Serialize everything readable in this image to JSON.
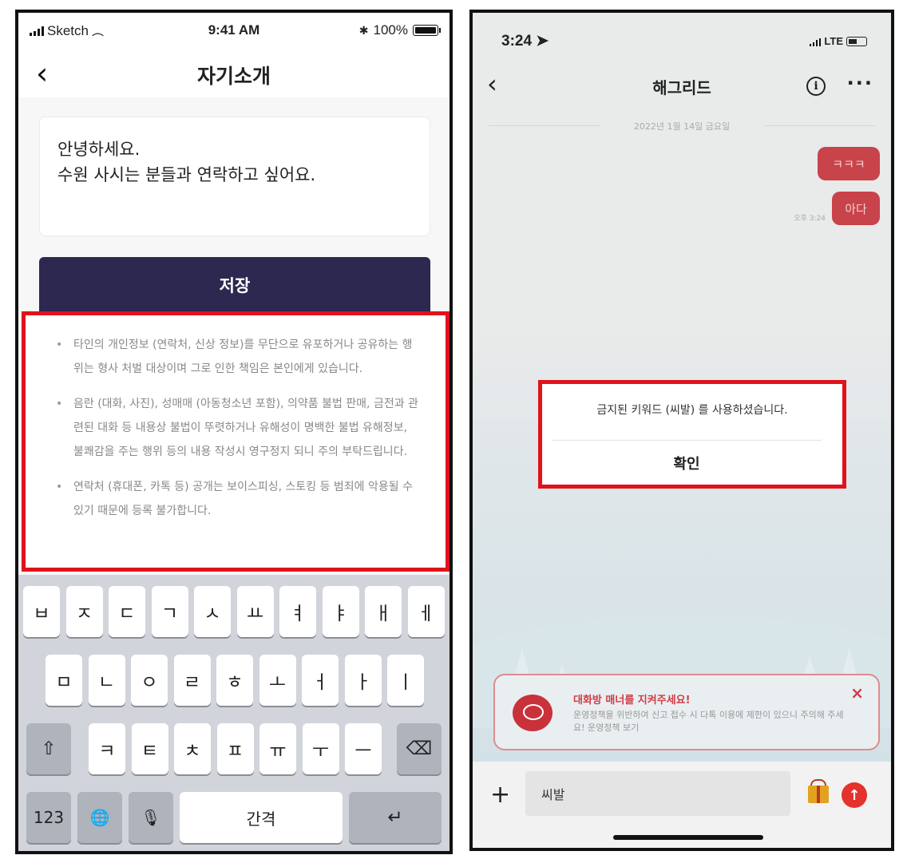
{
  "left": {
    "status": {
      "carrier": "Sketch",
      "time": "9:41 AM",
      "battery": "100%"
    },
    "header": {
      "back": "‹",
      "title": "자기소개"
    },
    "intro": {
      "line1": "안녕하세요.",
      "line2": "수원 사시는 분들과 연락하고 싶어요."
    },
    "save_label": "저장",
    "notices": [
      "타인의 개인정보 (연락처, 신상 정보)를 무단으로 유포하거나 공유하는 행위는 형사 처벌 대상이며 그로 인한 책임은 본인에게 있습니다.",
      "음란 (대화, 사진), 성매매 (아동청소년 포함), 의약품 불법 판매, 금전과 관련된 대화 등 내용상 불법이 뚜렷하거나 유해성이 명백한 불법 유해정보, 불쾌감을 주는 행위 등의 내용 작성시 영구정지 되니 주의 부탁드립니다.",
      "연락처 (휴대폰, 카톡 등) 공개는 보이스피싱, 스토킹 등 범죄에 악용될 수 있기 때문에 등록 불가합니다."
    ],
    "keyboard": {
      "row1": [
        "ㅂ",
        "ㅈ",
        "ㄷ",
        "ㄱ",
        "ㅅ",
        "ㅛ",
        "ㅕ",
        "ㅑ",
        "ㅐ",
        "ㅔ"
      ],
      "row2": [
        "ㅁ",
        "ㄴ",
        "ㅇ",
        "ㄹ",
        "ㅎ",
        "ㅗ",
        "ㅓ",
        "ㅏ",
        "ㅣ"
      ],
      "row3": [
        "ㅋ",
        "ㅌ",
        "ㅊ",
        "ㅍ",
        "ㅠ",
        "ㅜ",
        "ㅡ"
      ],
      "shift": "⇧",
      "backspace": "⌫",
      "num": "123",
      "globe": "🌐",
      "mic": "🎙",
      "space": "간격",
      "return": "↵"
    }
  },
  "right": {
    "status": {
      "time": "3:24 ➤",
      "network": "LTE"
    },
    "header": {
      "back": "‹",
      "title": "해그리드",
      "info": "i",
      "more": "···"
    },
    "date_divider": "2022년 1월 14일 금요일",
    "messages": [
      "ㅋㅋㅋ",
      "아다"
    ],
    "message_time": "오후 3:24",
    "dialog": {
      "message": "금지된 키워드 (씨발) 를 사용하셨습니다.",
      "confirm": "확인"
    },
    "banner": {
      "title": "대화방 매너를 지켜주세요!",
      "desc": "운영정책을 위반하여 신고 접수 시 다톡 이용에 제한이 있으니 주의해 주세요! 운영정책 보기",
      "close": "×"
    },
    "input": {
      "plus": "+",
      "value": "씨발",
      "send": "↑"
    }
  }
}
